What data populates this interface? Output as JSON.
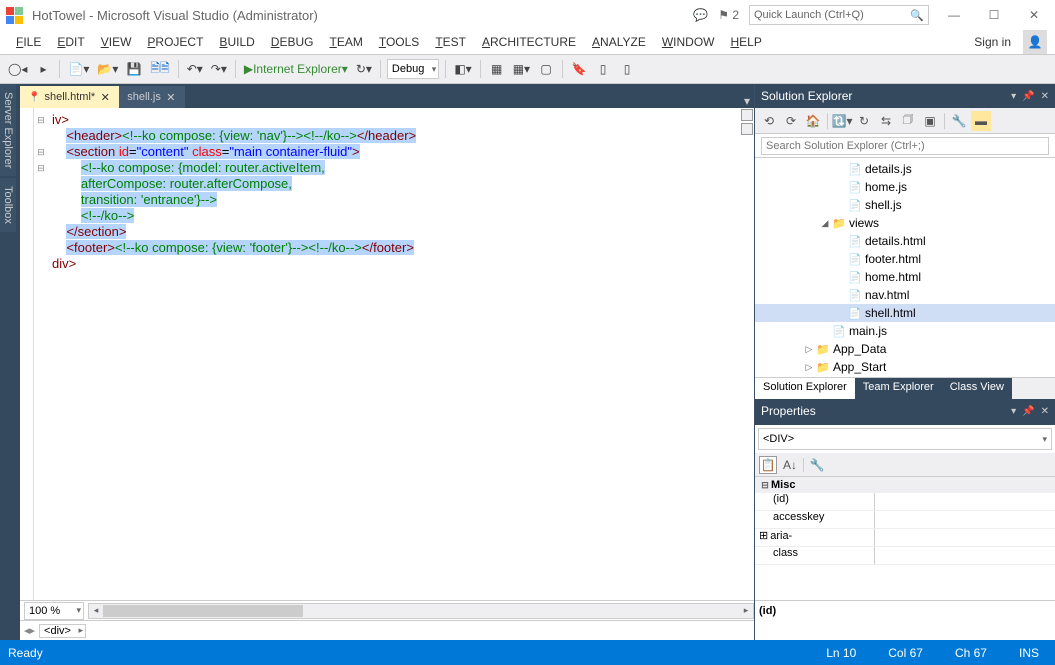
{
  "title": "HotTowel - Microsoft Visual Studio (Administrator)",
  "quick_launch_placeholder": "Quick Launch (Ctrl+Q)",
  "notification_count": "2",
  "menu": [
    "FILE",
    "EDIT",
    "VIEW",
    "PROJECT",
    "BUILD",
    "DEBUG",
    "TEAM",
    "TOOLS",
    "TEST",
    "ARCHITECTURE",
    "ANALYZE",
    "WINDOW",
    "HELP"
  ],
  "sign_in": "Sign in",
  "toolbar": {
    "run_label": "Internet Explorer",
    "config": "Debug"
  },
  "side_tabs": [
    "Server Explorer",
    "Toolbox"
  ],
  "tabs": [
    {
      "label": "shell.html*",
      "active": true,
      "lock": true
    },
    {
      "label": "shell.js",
      "active": false,
      "lock": false
    }
  ],
  "code_lines": [
    {
      "outline": "⊟",
      "html": "<span class='tag'>iv</span><span class='tag'>&gt;</span>"
    },
    {
      "outline": "",
      "html": "    <span class='sel'><span class='tag'>&lt;header&gt;</span><span class='cmt'>&lt;!--ko compose: {view: 'nav'}--&gt;&lt;!--/ko--&gt;</span><span class='tag'>&lt;/header&gt;</span></span>"
    },
    {
      "outline": "⊟",
      "html": "    <span class='sel'><span class='tag'>&lt;section</span> <span class='attr'>id</span>=<span class='str'>\"content\"</span> <span class='attr'>class</span>=<span class='str'>\"main container-fluid\"</span><span class='tag'>&gt;</span></span>"
    },
    {
      "outline": "⊟",
      "html": "        <span class='sel'><span class='cmt'>&lt;!--ko compose: {model: router.activeItem,</span></span>"
    },
    {
      "outline": "",
      "html": "        <span class='sel'><span class='cmt'>afterCompose: router.afterCompose,</span></span>"
    },
    {
      "outline": "",
      "html": "        <span class='sel'><span class='cmt'>transition: 'entrance'}--&gt;</span></span>"
    },
    {
      "outline": "",
      "html": "        <span class='sel'><span class='cmt'>&lt;!--/ko--&gt;</span></span>"
    },
    {
      "outline": "",
      "html": "    <span class='sel'><span class='tag'>&lt;/section&gt;</span></span>"
    },
    {
      "outline": "",
      "html": "    <span class='sel'><span class='tag'>&lt;footer&gt;</span><span class='cmt'>&lt;!--ko compose: {view: 'footer'}--&gt;&lt;!--/ko--&gt;</span><span class='tag'>&lt;/footer&gt;</span></span>"
    },
    {
      "outline": "",
      "html": "<span class='tag'>div</span><span class='tag'>&gt;</span>"
    }
  ],
  "zoom": "100 %",
  "breadcrumb": "<div>",
  "solution_explorer": {
    "title": "Solution Explorer",
    "search_placeholder": "Search Solution Explorer (Ctrl+;)",
    "tree": [
      {
        "indent": 5,
        "icon": "📄",
        "cls": "fjs",
        "label": "details.js"
      },
      {
        "indent": 5,
        "icon": "📄",
        "cls": "fjs",
        "label": "home.js"
      },
      {
        "indent": 5,
        "icon": "📄",
        "cls": "fjs",
        "label": "shell.js"
      },
      {
        "indent": 4,
        "tw": "◢",
        "icon": "📁",
        "cls": "ffolder",
        "label": "views"
      },
      {
        "indent": 5,
        "icon": "📄",
        "cls": "fhtml",
        "label": "details.html"
      },
      {
        "indent": 5,
        "icon": "📄",
        "cls": "fhtml",
        "label": "footer.html"
      },
      {
        "indent": 5,
        "icon": "📄",
        "cls": "fhtml",
        "label": "home.html"
      },
      {
        "indent": 5,
        "icon": "📄",
        "cls": "fhtml",
        "label": "nav.html"
      },
      {
        "indent": 5,
        "icon": "📄",
        "cls": "fhtml",
        "label": "shell.html",
        "sel": true
      },
      {
        "indent": 4,
        "icon": "📄",
        "cls": "fjs",
        "label": "main.js"
      },
      {
        "indent": 3,
        "tw": "▷",
        "icon": "📁",
        "cls": "ffolder",
        "label": "App_Data"
      },
      {
        "indent": 3,
        "tw": "▷",
        "icon": "📁",
        "cls": "ffolder",
        "label": "App_Start"
      }
    ],
    "tabs": [
      "Solution Explorer",
      "Team Explorer",
      "Class View"
    ]
  },
  "properties": {
    "title": "Properties",
    "selection": "<DIV>",
    "cat": "Misc",
    "rows": [
      {
        "k": "(id)",
        "v": ""
      },
      {
        "k": "accesskey",
        "v": ""
      },
      {
        "k": "aria-",
        "v": "",
        "exp": "⊞"
      },
      {
        "k": "class",
        "v": ""
      }
    ],
    "desc_key": "(id)"
  },
  "status": {
    "ready": "Ready",
    "ln": "Ln 10",
    "col": "Col 67",
    "ch": "Ch 67",
    "ins": "INS"
  }
}
